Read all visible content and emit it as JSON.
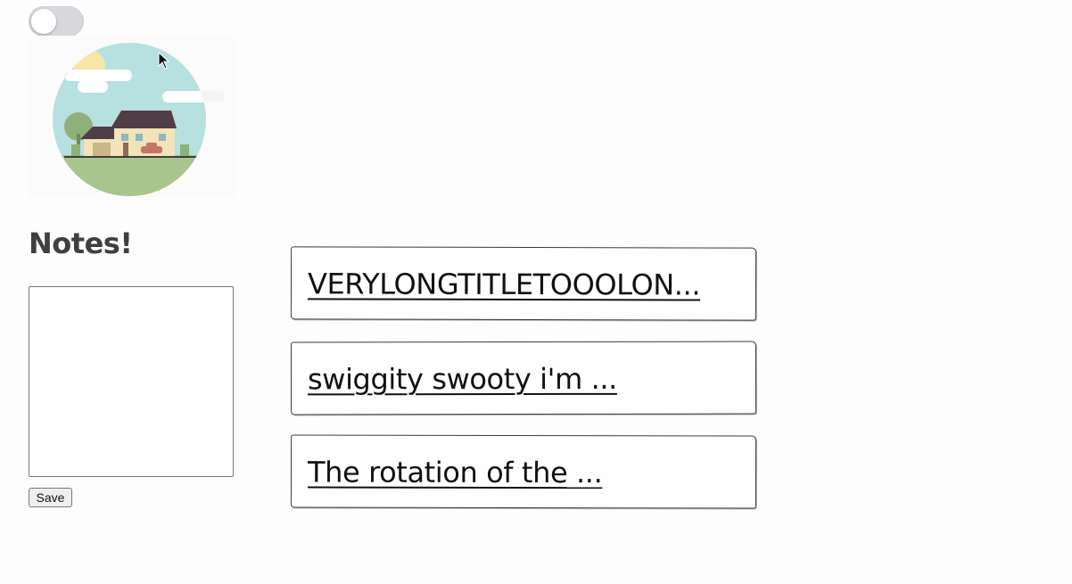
{
  "theme_toggle": {
    "state": "off"
  },
  "illustration": {
    "icon": "house-landscape-image"
  },
  "notes": {
    "heading": "Notes!",
    "textarea_value": "",
    "save_label": "Save"
  },
  "note_list": [
    {
      "title": "VERYLONGTITLETOOOLON..."
    },
    {
      "title": "swiggity swooty i'm ..."
    },
    {
      "title": "The rotation of the ..."
    }
  ]
}
